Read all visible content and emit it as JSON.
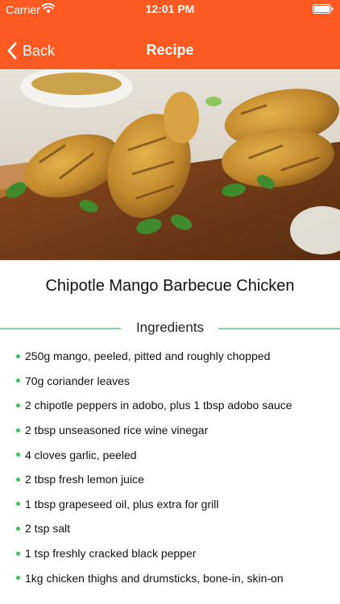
{
  "status_bar": {
    "carrier": "Carrier",
    "time": "12:01 PM",
    "wifi_icon": "wifi-icon",
    "battery_icon": "battery-icon"
  },
  "nav": {
    "back_label": "Back",
    "back_icon": "chevron-left-icon",
    "title": "Recipe"
  },
  "hero": {
    "image": "grilled-chicken-drumsticks-photo"
  },
  "recipe": {
    "title": "Chipotle Mango Barbecue Chicken"
  },
  "ingredients": {
    "heading": "Ingredients",
    "items": [
      "250g mango, peeled, pitted and roughly chopped",
      "70g coriander leaves",
      "2 chipotle peppers in adobo, plus 1 tbsp adobo sauce",
      "2 tbsp unseasoned rice wine vinegar",
      "4 cloves garlic, peeled",
      "2 tbsp fresh lemon juice",
      "1 tbsp grapeseed oil, plus extra for grill",
      "2 tsp salt",
      "1 tsp freshly cracked black pepper",
      "1kg chicken thighs and drumsticks, bone-in, skin-on"
    ]
  },
  "colors": {
    "accent": "#fd5a23",
    "divider": "#7ed8a0",
    "bullet": "#37c25a"
  }
}
